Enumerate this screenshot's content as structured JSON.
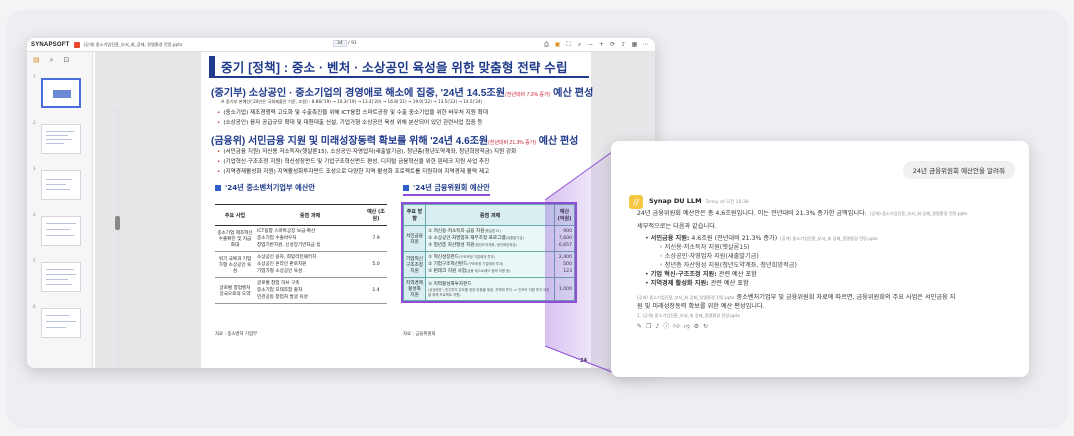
{
  "viewer": {
    "logo": "SYNAPSOFT",
    "file_name": "(공개) 중소기업진흥_부서_회_강제, 정명환경 전망.pptx",
    "page_current": "34",
    "page_total": "/ 91",
    "thumb_numbers": [
      "1",
      "2",
      "3",
      "4",
      "5",
      "6",
      "7",
      "8"
    ]
  },
  "document": {
    "title": "중기 [정책] : 중소 · 벤처 · 소상공인 육성을 위한 맞춤형 전략 수립",
    "heading1": "(중기부) 소상공인 · 중소기업의 경영애로 해소에 집중, '24년 14.5조원",
    "heading1_note": "(전년대비 7.3% 증가)",
    "heading1_tail": " 예산 편성",
    "note": "※ 중기부 본예산('24년은 국회제출안 기준, 조원) : 8.86('19) → 10.3('19) → 13.4('20) → 16.8('21) → 19.0('22) → 13.5('23) → 14.5('24)",
    "bullets1": [
      "(중소기업) 제조경쟁력 고도화 및 수출촉진을 위해 ICT융합 스마트공장 및 수출 중소기업을 위한 바우처 지원 확대",
      "(소상공인) 융자 공급규모 확대 및 대환대출 신설, 기업가형 소상공인 육성 위해 분산되어 있던 관련사업 집중 등"
    ],
    "heading2": "(금융위) 서민금융 지원 및 미래성장동력 확보를 위해 '24년 4.6조원",
    "heading2_note": "(전년대비 21.3% 증가)",
    "heading2_tail": " 예산 편성",
    "bullets2": [
      "(서민금융 지원) 저신용 저소득자(햇살론15), 소상공인·자영업자(새출발기금), 청년층(청년도약계좌, 청년희망적금) 지원 강화",
      "(기업혁신·구조조정 지원) 혁신성장펀드 및 기업구조혁신펀드 편성, 디지털 금융혁신을 위한 핀테크 지원 사업 추진",
      "(지역경제활성화 지원) 지역활성화투자펀드 조성으로 다양한 지역 활성화 프로젝트를 지원하여 지역경제 활력 제고"
    ],
    "left_table": {
      "heading": "'24년 중소벤처기업부 예산안",
      "headers": [
        "주요 사업",
        "중점 과제",
        "예산 (조원)"
      ],
      "rows": [
        {
          "name": "중소기업 제조혁신 수출확진 및 지급화대",
          "items": [
            "ICT융합 스마트공장 보급·확산",
            "중소기업 수출바우처",
            "창업기반지원, 신성장기반자금 등"
          ],
          "value": "7.9"
        },
        {
          "name": "위기 극복과 기업가형 소상공인 육성",
          "items": [
            "소상공인 융자, 희망리턴패키지",
            "소상공인 온라인 판로지원",
            "기업가형 소상공인 육성"
          ],
          "value": "5.0"
        },
        {
          "name": "글로벌 창업벤처 강국으로의 도약",
          "items": [
            "글로벌 창업 허브 구축",
            "중소기업 모태조합 출자",
            "민관공동 창업자 발굴 육성"
          ],
          "value": "1.4"
        }
      ],
      "source": "자료 : 중소벤처 기업부"
    },
    "right_table": {
      "heading": "'24년 금융위원회 예산안",
      "headers": [
        "주요 방향",
        "중점 과제",
        "예산 (억원)"
      ],
      "rows": [
        {
          "name": "서민금융 지원",
          "items": [
            {
              "text": "① 저신용·저소득자 금융 지원",
              "sub": "(햇살론15)",
              "value": "900"
            },
            {
              "text": "② 소상공인·자영업자 재무조정 프로그램",
              "sub": "(새출발기금)",
              "value": "7,600"
            },
            {
              "text": "③ 청년층 자산형성 지원",
              "sub": "(청년도약계좌, 청년희망적금)",
              "value": "6,657"
            }
          ]
        },
        {
          "name": "기업혁신 구조조정 지원",
          "items": [
            {
              "text": "① 혁신성장펀드",
              "sub": "(구조조정 기업에게 투자)",
              "value": "2,400"
            },
            {
              "text": "② 기업구조혁신펀드",
              "sub": "(구조조정 기업에게 투자)",
              "value": "500"
            },
            {
              "text": "③ 핀테크 지원 사업",
              "sub": "(금융 테스트베드 등에 지원 등)",
              "value": "123"
            }
          ]
        },
        {
          "name": "지역경제 활성화 지원",
          "items": [
            {
              "text": "① 지역활성화투자펀드",
              "sub": "(공공부문 : 민간투자 유도를 위한 마중물 제공, 지역에 투자 -> 인프라 지원 투자 매칭을 위해 프로젝트 지원)",
              "value": "1,000"
            }
          ]
        }
      ],
      "source": "자료 : 금융위원회"
    },
    "page_number": "34"
  },
  "chat": {
    "user_message": "24년 금융위원회 예산안을 알려줘",
    "bot_name": "Synap DU LLM",
    "bot_time": "Today at 오전 10:38",
    "summary": "24년 금융위원회 예산안은 총 4,6조원입니다. 이는 전년대비 21.3% 증가한 금액입니다.",
    "summary_ref": "(공개) 중소기업진흥_부서_회 강제_정명환경 전망.pptx",
    "detail_intro": "세부적으로는 다음과 같습니다.",
    "items": [
      {
        "label": "서민금융 지원:",
        "text": " 4.6조원 (전년대비 21.3% 증가)",
        "ref": "(공개) 중소기업진흥_부서_회 강제_정명환경 전망.pptx"
      },
      {
        "label": "",
        "text": "저신용·저소득자 지원(햇살론15)"
      },
      {
        "label": "",
        "text": "소상공인·자영업자 지원(새출발기금)"
      },
      {
        "label": "",
        "text": "청년층 자산형성 지원(청년도약계좌, 청년희망적금)"
      },
      {
        "label": "기업 혁신·구조조정 지원:",
        "text": " 관련 예산 포함"
      },
      {
        "label": "지역경제 활성화 지원:",
        "text": " 관련 예산 포함"
      }
    ],
    "closing_ref": "(공개) 중소기업진흥_부서_회 강제_정명환경 전망.pptx",
    "closing": "중소벤처기업부 및 금융위원회 자료에 따르면, 금융위원회의 주요 사업은 서민금융 지",
    "closing2": "원 및 미래성장동력 확보를 위한 예산 편성입니다.",
    "footnote": "1. (공개) 중소기업진흥_부서_회 강제_정명환경 전망.pptx"
  },
  "colors": {
    "brand_blue": "#1f3a8a",
    "highlight_purple": "#8e4fd6",
    "avatar_yellow": "#f7c744"
  }
}
